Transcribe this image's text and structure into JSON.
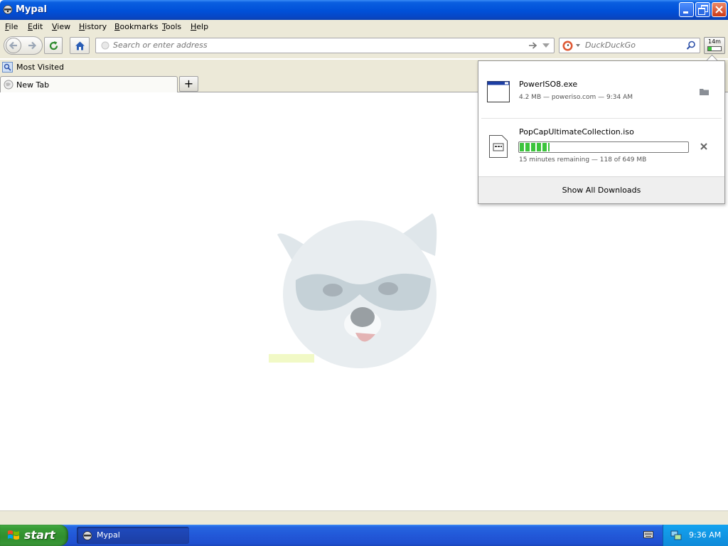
{
  "window": {
    "title": "Mypal"
  },
  "menubar": {
    "items": [
      {
        "label": "File",
        "accel": "F",
        "rest": "ile"
      },
      {
        "label": "Edit",
        "accel": "E",
        "rest": "dit"
      },
      {
        "label": "View",
        "accel": "V",
        "rest": "iew"
      },
      {
        "label": "History",
        "accel": "H",
        "rest": "istory"
      },
      {
        "label": "Bookmarks",
        "accel": "B",
        "rest": "ookmarks"
      },
      {
        "label": "Tools",
        "accel": "T",
        "rest": "ools"
      },
      {
        "label": "Help",
        "accel": "H",
        "rest": "elp"
      }
    ]
  },
  "navbar": {
    "url_placeholder": "Search or enter address",
    "search_placeholder": "DuckDuckGo",
    "downloads_badge": "14m"
  },
  "bookmarks": {
    "most_visited": "Most Visited"
  },
  "tabs": [
    {
      "label": "New Tab"
    }
  ],
  "downloads": {
    "items": [
      {
        "name": "PowerISO8.exe",
        "status": "4.2 MB — poweriso.com — 9:34 AM",
        "state": "complete"
      },
      {
        "name": "PopCapUltimateCollection.iso",
        "status": "15 minutes remaining — 118 of 649 MB",
        "state": "downloading",
        "progress": 0.18
      }
    ],
    "show_all": "Show All Downloads"
  },
  "taskbar": {
    "start": "start",
    "task_label": "Mypal",
    "clock": "9:36 AM"
  },
  "colors": {
    "titlebar": "#0050d8",
    "chrome": "#ece9d8",
    "progress": "#3cc43c",
    "taskbar": "#2258d8",
    "start": "#2f8d2d"
  }
}
